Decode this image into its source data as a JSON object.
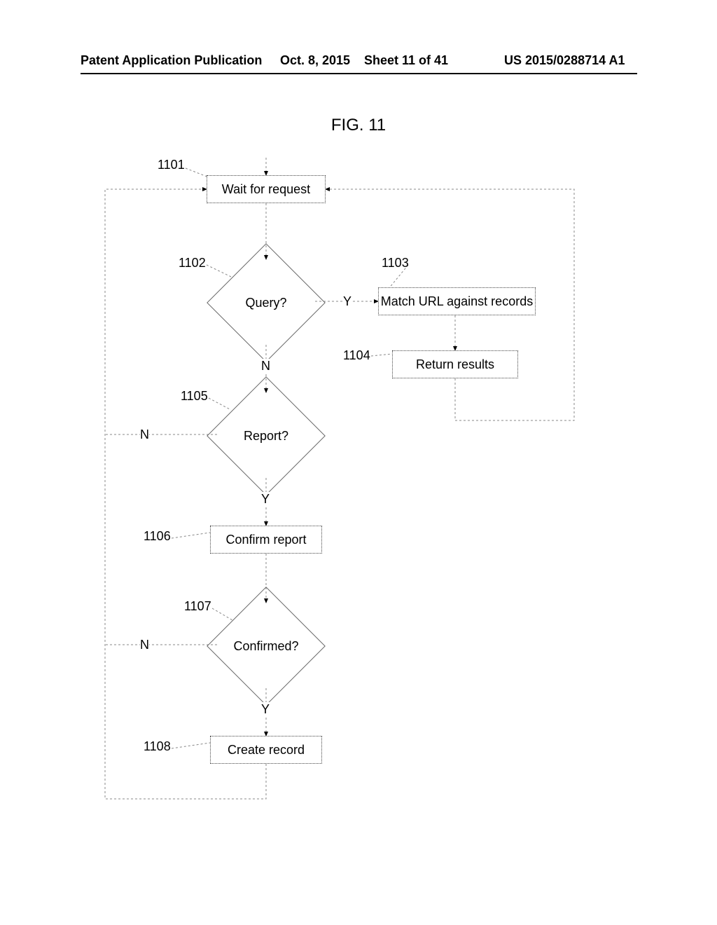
{
  "header": {
    "left": "Patent Application Publication",
    "date": "Oct. 8, 2015",
    "sheet": "Sheet 11 of 41",
    "pubno": "US 2015/0288714 A1"
  },
  "figure": {
    "title": "FIG. 11"
  },
  "nodes": {
    "n1101": {
      "ref": "1101",
      "label": "Wait for request"
    },
    "n1102": {
      "ref": "1102",
      "label": "Query?"
    },
    "n1103": {
      "ref": "1103",
      "label": "Match URL against records"
    },
    "n1104": {
      "ref": "1104",
      "label": "Return results"
    },
    "n1105": {
      "ref": "1105",
      "label": "Report?"
    },
    "n1106": {
      "ref": "1106",
      "label": "Confirm report"
    },
    "n1107": {
      "ref": "1107",
      "label": "Confirmed?"
    },
    "n1108": {
      "ref": "1108",
      "label": "Create record"
    }
  },
  "edges": {
    "y": "Y",
    "n": "N"
  }
}
